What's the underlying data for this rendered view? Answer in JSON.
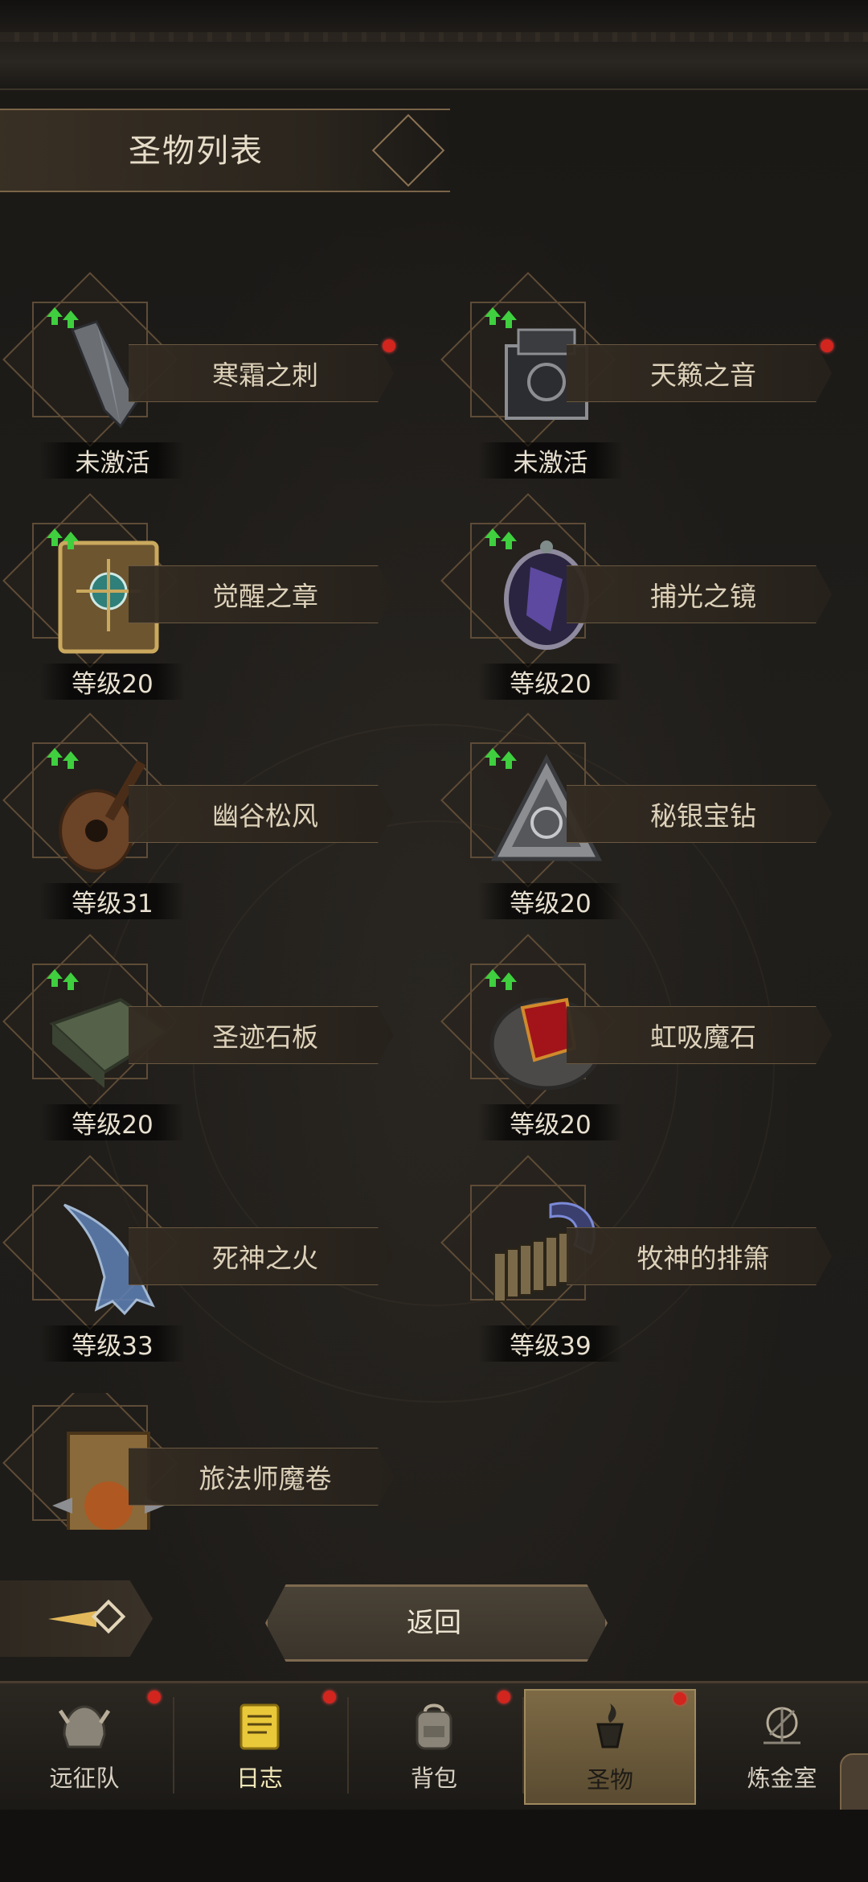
{
  "header": {
    "title": "圣物列表"
  },
  "relics": [
    {
      "name": "寒霜之刺",
      "status": "未激活",
      "icon": "ice-shard-icon",
      "upgrade": true,
      "dot": true
    },
    {
      "name": "天籁之音",
      "status": "未激活",
      "icon": "dark-box-icon",
      "upgrade": true,
      "dot": true
    },
    {
      "name": "觉醒之章",
      "status": "等级20",
      "icon": "tome-icon",
      "upgrade": true,
      "dot": false
    },
    {
      "name": "捕光之镜",
      "status": "等级20",
      "icon": "mirror-icon",
      "upgrade": true,
      "dot": false
    },
    {
      "name": "幽谷松风",
      "status": "等级31",
      "icon": "lute-icon",
      "upgrade": true,
      "dot": false
    },
    {
      "name": "秘银宝钻",
      "status": "等级20",
      "icon": "pyramid-icon",
      "upgrade": true,
      "dot": false
    },
    {
      "name": "圣迹石板",
      "status": "等级20",
      "icon": "stone-slab-icon",
      "upgrade": true,
      "dot": false
    },
    {
      "name": "虹吸魔石",
      "status": "等级20",
      "icon": "red-stone-icon",
      "upgrade": true,
      "dot": false
    },
    {
      "name": "死神之火",
      "status": "等级33",
      "icon": "spectral-hand-icon",
      "upgrade": false,
      "dot": false
    },
    {
      "name": "牧神的排箫",
      "status": "等级39",
      "icon": "pan-flute-icon",
      "upgrade": false,
      "dot": false
    },
    {
      "name": "旅法师魔卷",
      "status": "",
      "icon": "scroll-icon",
      "upgrade": false,
      "dot": false
    }
  ],
  "actions": {
    "return_label": "返回"
  },
  "nav": [
    {
      "label": "远征队",
      "icon": "helmet-icon",
      "dot": true,
      "active": false
    },
    {
      "label": "日志",
      "icon": "journal-icon",
      "dot": true,
      "active": false
    },
    {
      "label": "背包",
      "icon": "backpack-icon",
      "dot": true,
      "active": false
    },
    {
      "label": "圣物",
      "icon": "relic-icon",
      "dot": true,
      "active": true
    },
    {
      "label": "炼金室",
      "icon": "alchemy-icon",
      "dot": false,
      "active": false
    }
  ],
  "colors": {
    "accent_gold": "#9f8a5e",
    "text_primary": "#ddd1b9",
    "notification_red": "#d2251e",
    "upgrade_green": "#3fcf3f"
  }
}
